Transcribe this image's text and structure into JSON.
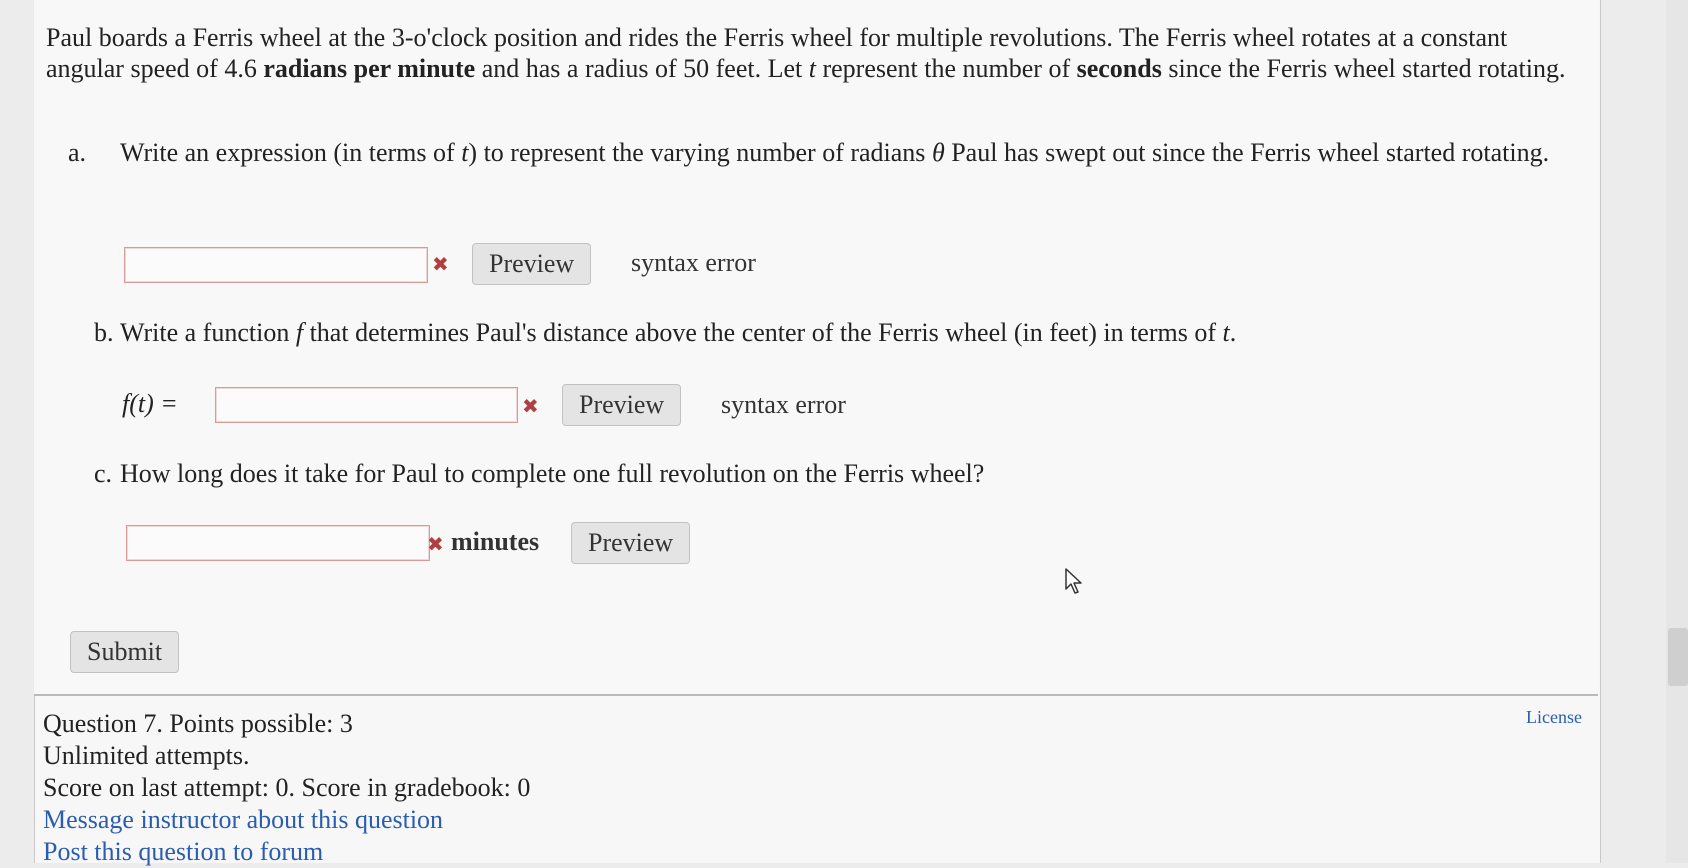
{
  "question": {
    "intro": {
      "p1": "Paul boards a Ferris wheel at the 3-o'clock position and rides the Ferris wheel for multiple revolutions. The Ferris wheel rotates at a constant angular speed of 4.6 ",
      "b1": "radians per minute",
      "p2": " and has a radius of 50 feet. Let ",
      "v1": "t",
      "p3": " represent the number of ",
      "b2": "seconds",
      "p4": " since the Ferris wheel started rotating."
    },
    "part_a": {
      "label": "a.",
      "t1": "Write an expression (in terms of ",
      "v": "t",
      "t2": ") to represent the varying number of radians ",
      "theta": "θ",
      "t3": " Paul has swept out since the Ferris wheel started rotating.",
      "input_value": "",
      "status_icon": "x-mark-icon",
      "preview_label": "Preview",
      "error_text": "syntax error"
    },
    "part_b": {
      "label": "b.",
      "t1": "Write a function ",
      "f": "f",
      "t2": " that determines Paul's distance above the center of the Ferris wheel (in feet) in terms of ",
      "v": "t",
      "t3": ".",
      "fn_label": "f(t) =",
      "input_value": "",
      "status_icon": "x-mark-icon",
      "preview_label": "Preview",
      "error_text": "syntax error"
    },
    "part_c": {
      "label": "c.",
      "text": "How long does it take for Paul to complete one full revolution on the Ferris wheel?",
      "input_value": "",
      "status_icon": "x-mark-icon",
      "units": "minutes",
      "preview_label": "Preview"
    },
    "submit_label": "Submit"
  },
  "info": {
    "line1": "Question 7. Points possible: 3",
    "line2": "Unlimited attempts.",
    "line3": "Score on last attempt: 0. Score in gradebook: 0",
    "message_link": "Message instructor about this question",
    "forum_link": "Post this question to forum",
    "license": "License"
  },
  "colors": {
    "link": "#2a5db0",
    "error_mark": "#b04040",
    "invalid_border": "#d99a9a"
  }
}
